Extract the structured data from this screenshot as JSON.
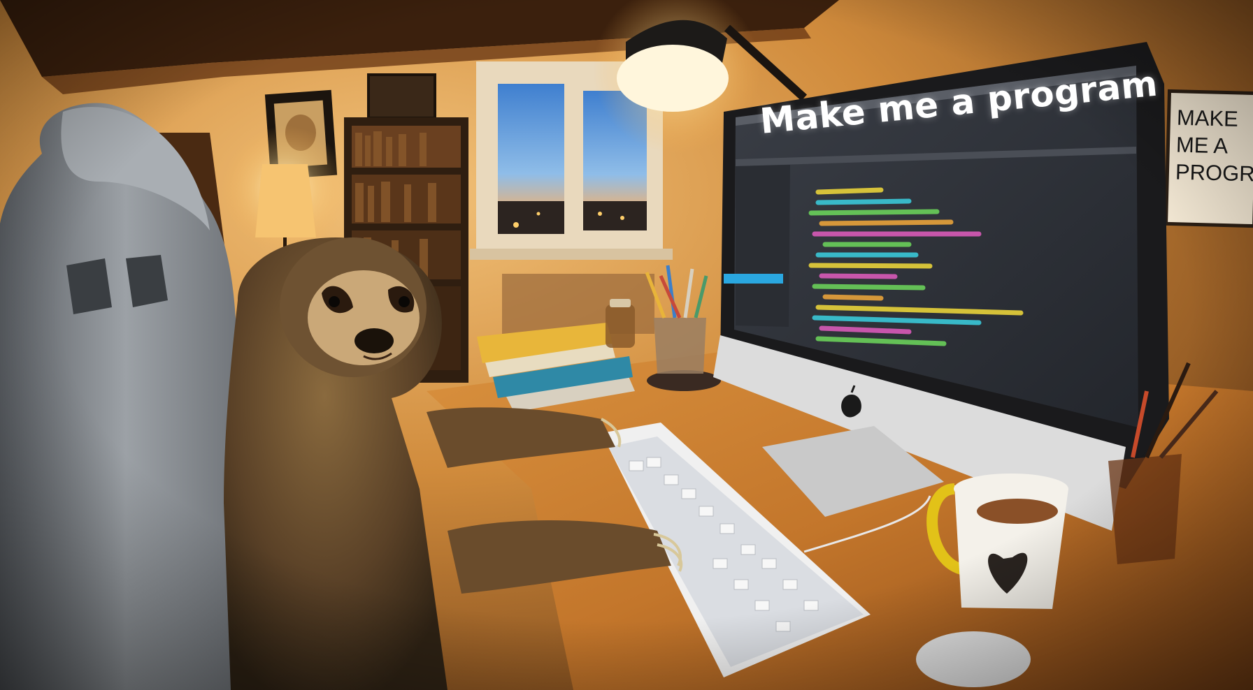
{
  "monitor": {
    "screen_title": "Make me a program"
  },
  "poster": {
    "lines": [
      "MAKE",
      "ME A",
      "PROGRAM"
    ]
  },
  "colors": {
    "wall_warm": "#d8953f",
    "desk": "#c3762b",
    "screen_bg": "#2d3037",
    "chair": "#8e9399",
    "sloth_fur": "#5a4127",
    "mug_handle": "#e2c218",
    "window_sky": "#7fb3e6"
  },
  "icons": {
    "monitor_logo": "apple-logo-icon",
    "mug_print": "heart-icon"
  }
}
